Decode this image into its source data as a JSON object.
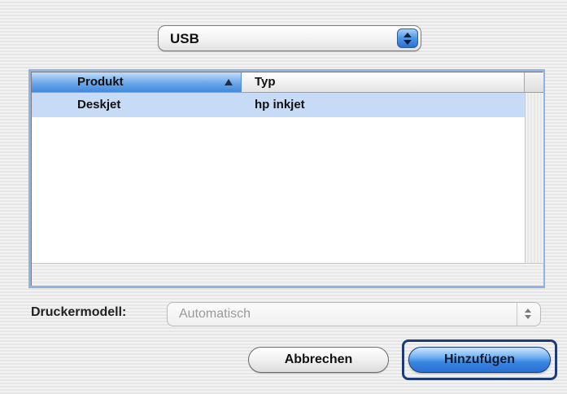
{
  "connection_popup": {
    "value": "USB"
  },
  "printer_table": {
    "columns": [
      "Produkt",
      "Typ"
    ],
    "sort_column": "Produkt",
    "rows": [
      {
        "produkt": "Deskjet",
        "typ": "hp inkjet",
        "selected": true
      }
    ]
  },
  "printer_model": {
    "label": "Druckermodell:",
    "value": "Automatisch",
    "enabled": false
  },
  "buttons": {
    "cancel_label": "Abbrechen",
    "add_label": "Hinzufügen"
  },
  "icons": {
    "connection_popup_arrows": "up-down-chevron-icon",
    "sort_indicator": "sort-ascending-icon",
    "model_popup_arrows": "up-down-chevron-icon"
  },
  "colors": {
    "accent": "#4189dc",
    "selection": "#c7dbf6",
    "default_button": "#2a6ed2",
    "focus_ring": "#1d3c78"
  }
}
